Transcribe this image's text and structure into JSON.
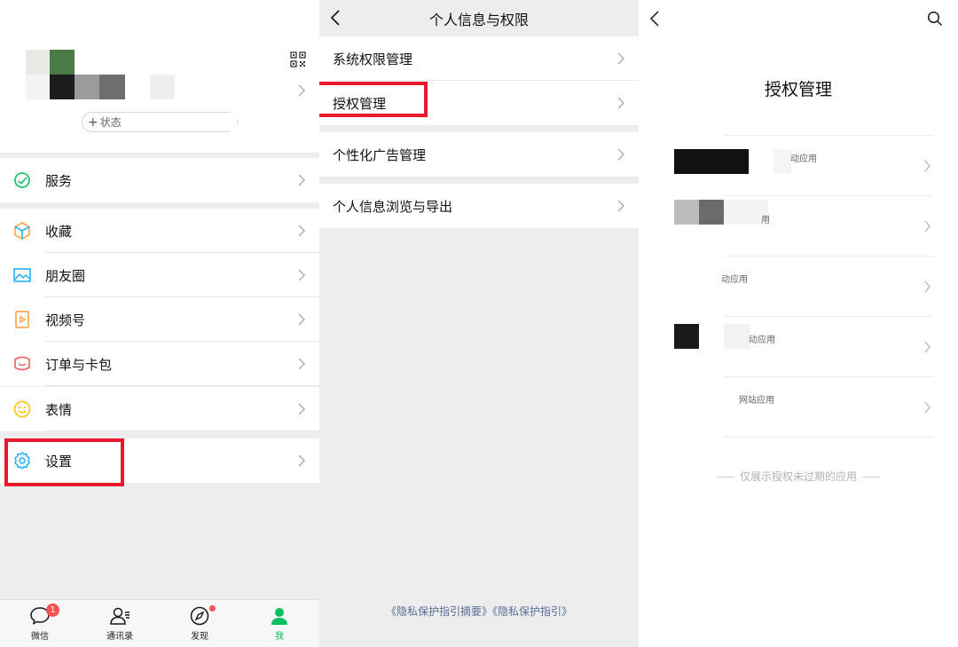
{
  "me_screen": {
    "status_label": "状态",
    "menu_items": [
      {
        "label": "服务",
        "icon": "service-icon"
      },
      {
        "label": "收藏",
        "icon": "favorites-icon"
      },
      {
        "label": "朋友圈",
        "icon": "moments-icon"
      },
      {
        "label": "视频号",
        "icon": "channels-icon"
      },
      {
        "label": "订单与卡包",
        "icon": "orders-cards-icon"
      },
      {
        "label": "表情",
        "icon": "sticker-icon"
      },
      {
        "label": "设置",
        "icon": "settings-icon"
      }
    ],
    "tabbar": [
      {
        "label": "微信",
        "icon": "chat-icon",
        "badge": "1"
      },
      {
        "label": "通讯录",
        "icon": "contacts-icon"
      },
      {
        "label": "发现",
        "icon": "discover-icon"
      },
      {
        "label": "我",
        "icon": "me-icon",
        "active": true
      }
    ],
    "accent_color": "#07c160",
    "highlight_color": "#e8192c"
  },
  "privacy_screen": {
    "title": "个人信息与权限",
    "items": [
      {
        "label": "系统权限管理"
      },
      {
        "label": "授权管理"
      },
      {
        "label": "个性化广告管理"
      },
      {
        "label": "个人信息浏览与导出"
      }
    ],
    "footer_links": [
      "《隐私保护指引摘要》",
      "《隐私保护指引》"
    ]
  },
  "auth_screen": {
    "title": "授权管理",
    "apps": [
      {
        "tag": "动应用"
      },
      {
        "tag": "用"
      },
      {
        "tag": "动应用"
      },
      {
        "tag": "动应用"
      },
      {
        "tag": "网站应用"
      }
    ],
    "footer_note": "仅展示授权未过期的应用"
  }
}
